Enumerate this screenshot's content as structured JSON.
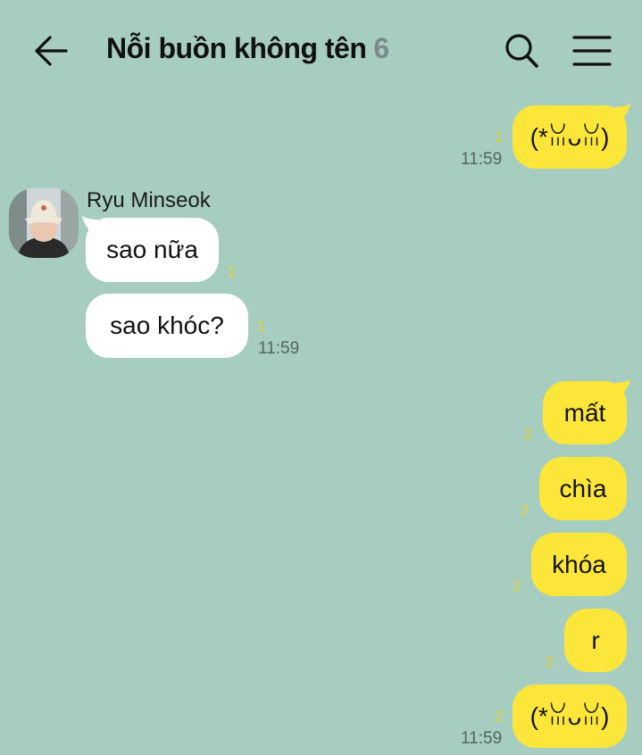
{
  "header": {
    "back_icon": "arrow-left-icon",
    "title": "Nỗi buồn không tên",
    "member_count": "6",
    "search_icon": "search-icon",
    "menu_icon": "hamburger-menu-icon"
  },
  "colors": {
    "background": "#a6cdc0",
    "my_bubble": "#fde63a",
    "their_bubble": "#ffffff",
    "unread_count": "#e8d23a",
    "member_count": "#7a8a8a"
  },
  "messages": [
    {
      "from": "me",
      "text": "(*ꈍᴗꈍ)",
      "unread": "1",
      "time": "11:59"
    },
    {
      "from": "Ryu Minseok",
      "text": "sao nữa",
      "unread": "1",
      "time": ""
    },
    {
      "from": "Ryu Minseok",
      "text": "sao khóc?",
      "unread": "1",
      "time": "11:59"
    },
    {
      "from": "me",
      "text": "mất",
      "unread": "2",
      "time": ""
    },
    {
      "from": "me",
      "text": "chìa",
      "unread": "2",
      "time": ""
    },
    {
      "from": "me",
      "text": "khóa",
      "unread": "2",
      "time": ""
    },
    {
      "from": "me",
      "text": "r",
      "unread": "2",
      "time": ""
    },
    {
      "from": "me",
      "text": "(*ꈍᴗꈍ)",
      "unread": "2",
      "time": "11:59"
    }
  ],
  "sender": {
    "name": "Ryu Minseok",
    "avatar_icon": "profile-photo-avatar"
  }
}
